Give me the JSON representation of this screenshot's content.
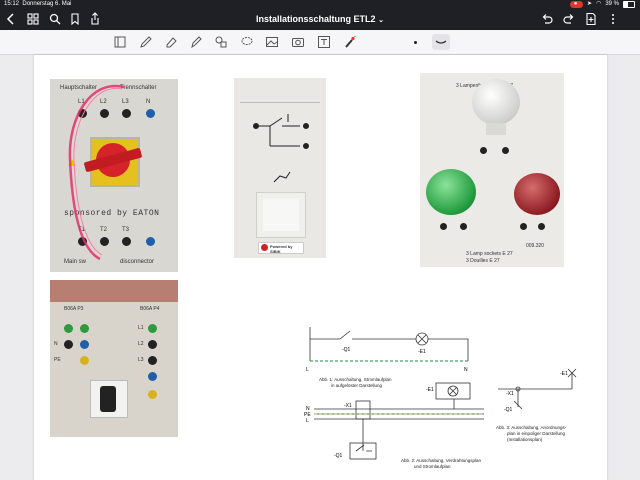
{
  "status": {
    "time": "15:12",
    "date": "Donnerstag 6. Mai",
    "battery": "39 %"
  },
  "header": {
    "title": "Installationsschaltung ETL2"
  },
  "photos": {
    "switch_panel": {
      "top_label_left": "Hauptschalter",
      "top_label_right": "Trennschalter",
      "terminals_top": [
        "L1",
        "L2",
        "L3",
        "N"
      ],
      "terminals_bottom": [
        "T1",
        "T2",
        "T3"
      ],
      "sponsor": "sponsored by EATON",
      "bottom_label_left": "Main sw",
      "bottom_label_right": "disconnector"
    },
    "sibik_panel": {
      "brand": "Powered by SIBIK"
    },
    "lamp_panel": {
      "top": "3 Lampenfassungen E 27",
      "bottom1": "3 Lamp sockets E 27",
      "bottom2": "3 Douilles E 27",
      "code": "009.320"
    },
    "supply_panel": {
      "fuse1": "B06A P3",
      "fuse2": "B06A P4",
      "labels": [
        "L1",
        "L2",
        "L3",
        "N",
        "PE"
      ]
    }
  },
  "diagrams": {
    "abb1": {
      "caption1": "Abb. 1:  Ausschaltung, Stromlaufplan",
      "caption2": "in aufgelöster Darstellung",
      "labels": [
        "L",
        "N",
        "-Q1",
        "-E1",
        "-X1"
      ]
    },
    "abb2": {
      "caption1": "Abb. 2:  Ausschaltung, Verdrahtungsplan",
      "caption2": "und Stromlaufplan",
      "labels": [
        "-Q1",
        "-E1",
        "-X1",
        "N",
        "PE",
        "L"
      ]
    },
    "abb3": {
      "caption1": "Abb. 3:  Ausschaltung, Anordnungs-",
      "caption2": "plan in einpoliger Darstellung",
      "caption3": "(Installationsplan)",
      "labels": [
        "-E1",
        "-X1",
        "-Q1"
      ]
    }
  }
}
